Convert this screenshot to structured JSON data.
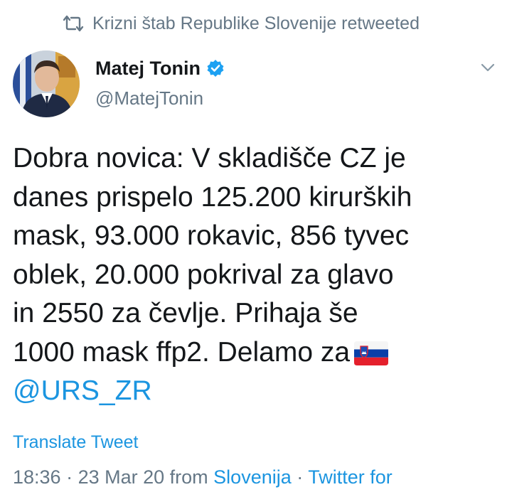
{
  "retweet_context": {
    "icon": "retweet-icon",
    "text": "Krizni štab Republike Slovenije retweeted"
  },
  "author": {
    "avatar_icon": "avatar",
    "display_name": "Matej Tonin",
    "verified_icon": "verified-badge-icon",
    "handle": "@MatejTonin"
  },
  "tweet": {
    "lines": [
      "Dobra novica: V skladišče CZ je",
      "danes prispelo 125.200 kirurških",
      "mask, 93.000 rokavic, 856 tyvec",
      "oblek, 20.000 pokrival za glavo",
      "in 2550 za čevlje. Prihaja še",
      "1000 mask ffp2. Delamo za"
    ],
    "emoji": "slovenia-flag-emoji",
    "mention": "@URS_ZR"
  },
  "actions": {
    "translate_label": "Translate Tweet",
    "more_icon": "chevron-down-icon"
  },
  "meta": {
    "time": "18:36",
    "sep1": " · ",
    "date": "23 Mar 20",
    "from_word": " from ",
    "location": "Slovenija",
    "sep2": " · ",
    "source": "Twitter for"
  },
  "colors": {
    "link": "#1b95e0",
    "secondary_text": "#657786",
    "primary_text": "#14171a",
    "verified": "#1da1f2"
  }
}
